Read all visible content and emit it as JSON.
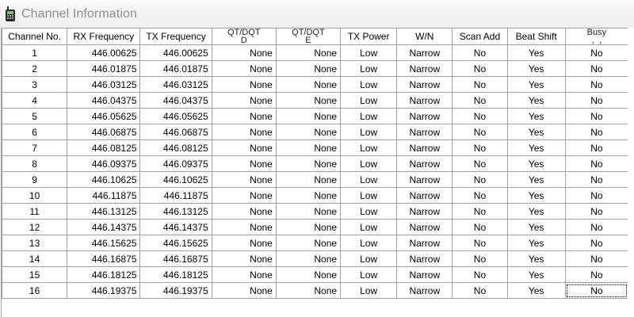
{
  "window": {
    "title": "Channel Information",
    "icon": "radio-icon"
  },
  "table": {
    "columns": [
      "Channel No.",
      "RX Frequency",
      "TX Frequency",
      "QT/DQT D",
      "QT/DQT E",
      "TX Power",
      "W/N",
      "Scan Add",
      "Beat Shift",
      "Busy Lock"
    ],
    "column_header_display": [
      "Channel No.",
      "RX Frequency",
      "TX Frequency",
      "QT/DQT\nD",
      "QT/DQT\nE",
      "TX Power",
      "W/N",
      "Scan Add",
      "Beat Shift",
      "Busy\n,  ,"
    ],
    "rows": [
      [
        "1",
        "446.00625",
        "446.00625",
        "None",
        "None",
        "Low",
        "Narrow",
        "No",
        "Yes",
        "No"
      ],
      [
        "2",
        "446.01875",
        "446.01875",
        "None",
        "None",
        "Low",
        "Narrow",
        "No",
        "Yes",
        "No"
      ],
      [
        "3",
        "446.03125",
        "446.03125",
        "None",
        "None",
        "Low",
        "Narrow",
        "No",
        "Yes",
        "No"
      ],
      [
        "4",
        "446.04375",
        "446.04375",
        "None",
        "None",
        "Low",
        "Narrow",
        "No",
        "Yes",
        "No"
      ],
      [
        "5",
        "446.05625",
        "446.05625",
        "None",
        "None",
        "Low",
        "Narrow",
        "No",
        "Yes",
        "No"
      ],
      [
        "6",
        "446.06875",
        "446.06875",
        "None",
        "None",
        "Low",
        "Narrow",
        "No",
        "Yes",
        "No"
      ],
      [
        "7",
        "446.08125",
        "446.08125",
        "None",
        "None",
        "Low",
        "Narrow",
        "No",
        "Yes",
        "No"
      ],
      [
        "8",
        "446.09375",
        "446.09375",
        "None",
        "None",
        "Low",
        "Narrow",
        "No",
        "Yes",
        "No"
      ],
      [
        "9",
        "446.10625",
        "446.10625",
        "None",
        "None",
        "Low",
        "Narrow",
        "No",
        "Yes",
        "No"
      ],
      [
        "10",
        "446.11875",
        "446.11875",
        "None",
        "None",
        "Low",
        "Narrow",
        "No",
        "Yes",
        "No"
      ],
      [
        "11",
        "446.13125",
        "446.13125",
        "None",
        "None",
        "Low",
        "Narrow",
        "No",
        "Yes",
        "No"
      ],
      [
        "12",
        "446.14375",
        "446.14375",
        "None",
        "None",
        "Low",
        "Narrow",
        "No",
        "Yes",
        "No"
      ],
      [
        "13",
        "446.15625",
        "446.15625",
        "None",
        "None",
        "Low",
        "Narrow",
        "No",
        "Yes",
        "No"
      ],
      [
        "14",
        "446.16875",
        "446.16875",
        "None",
        "None",
        "Low",
        "Narrow",
        "No",
        "Yes",
        "No"
      ],
      [
        "15",
        "446.18125",
        "446.18125",
        "None",
        "None",
        "Low",
        "Narrow",
        "No",
        "Yes",
        "No"
      ],
      [
        "16",
        "446.19375",
        "446.19375",
        "None",
        "None",
        "Low",
        "Narrow",
        "No",
        "Yes",
        "No"
      ]
    ],
    "focused_cell": {
      "row": 16,
      "column": "Busy Lock"
    }
  }
}
